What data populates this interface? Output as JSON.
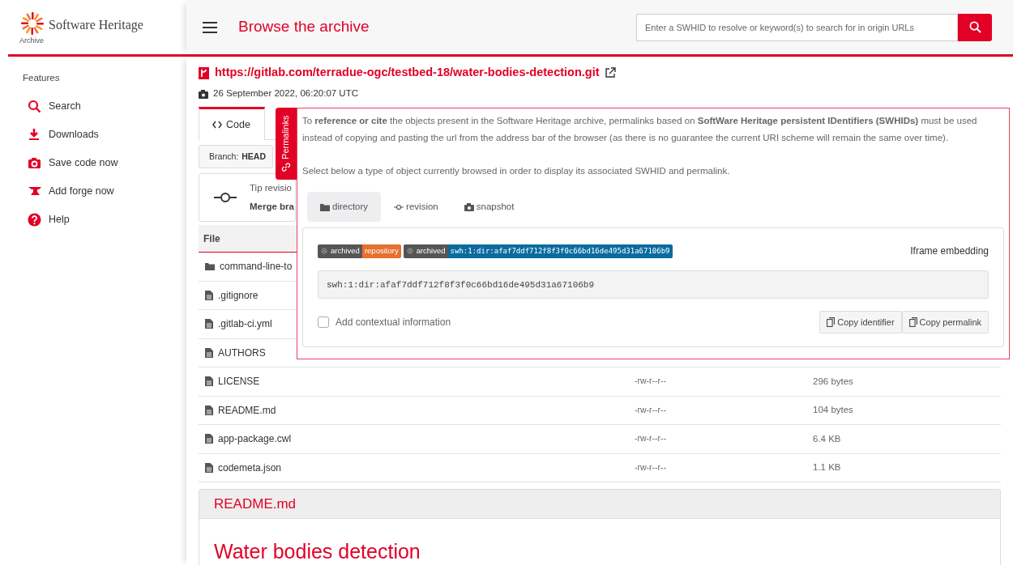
{
  "brand": {
    "name": "Software Heritage",
    "subtitle": "Archive"
  },
  "header": {
    "title": "Browse the archive",
    "search": {
      "placeholder": "Enter a SWHID to resolve or keyword(s) to search for in origin URLs"
    }
  },
  "sidebar": {
    "heading": "Features",
    "items": [
      {
        "label": "Search"
      },
      {
        "label": "Downloads"
      },
      {
        "label": "Save code now"
      },
      {
        "label": "Add forge now"
      },
      {
        "label": "Help"
      }
    ]
  },
  "origin": {
    "url": "https://gitlab.com/terradue-ogc/testbed-18/water-bodies-detection.git",
    "date": "26 September 2022, 06:20:07 UTC"
  },
  "tabs": [
    {
      "label": "Code",
      "selected": true
    }
  ],
  "branch": {
    "label": "Branch:",
    "value": "HEAD"
  },
  "revision": {
    "label": "Tip revisio",
    "message": "Merge bra"
  },
  "files": {
    "columns": [
      "File"
    ],
    "rows": [
      {
        "kind": "folder",
        "name": "command-line-to"
      },
      {
        "kind": "file",
        "name": ".gitignore"
      },
      {
        "kind": "file",
        "name": ".gitlab-ci.yml"
      },
      {
        "kind": "file",
        "name": "AUTHORS"
      },
      {
        "kind": "file",
        "name": "LICENSE",
        "perms": "-rw-r--r--",
        "size": "296 bytes"
      },
      {
        "kind": "file",
        "name": "README.md",
        "perms": "-rw-r--r--",
        "size": "104 bytes"
      },
      {
        "kind": "file",
        "name": "app-package.cwl",
        "perms": "-rw-r--r--",
        "size": "6.4 KB"
      },
      {
        "kind": "file",
        "name": "codemeta.json",
        "perms": "-rw-r--r--",
        "size": "1.1 KB"
      }
    ]
  },
  "readme": {
    "title": "README.md",
    "heading": "Water bodies detection"
  },
  "permalinks": {
    "tab_label": "Permalinks",
    "intro": "To **reference or cite** the objects present in the Software Heritage archive, permalinks based on **SoftWare Heritage persistent IDentifiers (SWHIDs)** must be used instead of copying and pasting the url from the address bar of the browser (as there is no guarantee the current URI scheme will remain the same over time).",
    "select_text": "Select below a type of object currently browsed in order to display its associated SWHID and permalink.",
    "object_tabs": [
      {
        "label": "directory",
        "selected": true
      },
      {
        "label": "revision",
        "selected": false
      },
      {
        "label": "snapshot",
        "selected": false
      }
    ],
    "badges": [
      {
        "label": "archived",
        "value": "repository",
        "color": "#e6702e"
      },
      {
        "label": "archived",
        "value": "swh:1:dir:afaf7ddf712f8f3f0c66bd16de495d31a67106b9",
        "color": "#0a6b9e"
      }
    ],
    "iframe_label": "Iframe embedding",
    "swhid": "swh:1:dir:afaf7ddf712f8f3f0c66bd16de495d31a67106b9",
    "contextual": {
      "label": "Add contextual information",
      "checked": false
    },
    "buttons": [
      "Copy identifier",
      "Copy permalink"
    ]
  }
}
